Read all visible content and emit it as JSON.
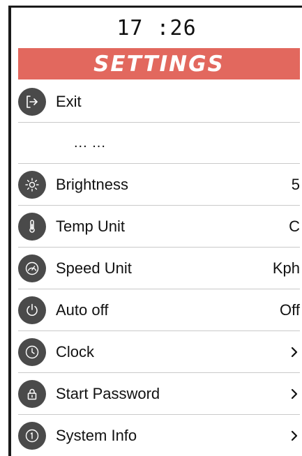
{
  "status": {
    "time": "17 :26"
  },
  "header": {
    "title": "SETTINGS",
    "color": "#e2685e"
  },
  "menu": {
    "items": [
      {
        "id": "exit",
        "label": "Exit",
        "icon": "exit-icon"
      },
      {
        "id": "more",
        "label": "... ..."
      },
      {
        "id": "brightness",
        "label": "Brightness",
        "value": "5",
        "icon": "brightness-icon"
      },
      {
        "id": "temp-unit",
        "label": "Temp Unit",
        "value": "C",
        "icon": "thermometer-icon"
      },
      {
        "id": "speed-unit",
        "label": "Speed Unit",
        "value": "Kph",
        "icon": "speedometer-icon"
      },
      {
        "id": "auto-off",
        "label": "Auto off",
        "value": "Off",
        "icon": "power-icon"
      },
      {
        "id": "clock",
        "label": "Clock",
        "value": ">",
        "icon": "clock-icon"
      },
      {
        "id": "start-password",
        "label": "Start Password",
        "value": ">",
        "icon": "lock-icon"
      },
      {
        "id": "system-info",
        "label": "System Info",
        "value": ">",
        "icon": "info-icon"
      }
    ]
  },
  "theme": {
    "icon_bg": "#4a4a4a",
    "divider": "#c9c9c9"
  }
}
